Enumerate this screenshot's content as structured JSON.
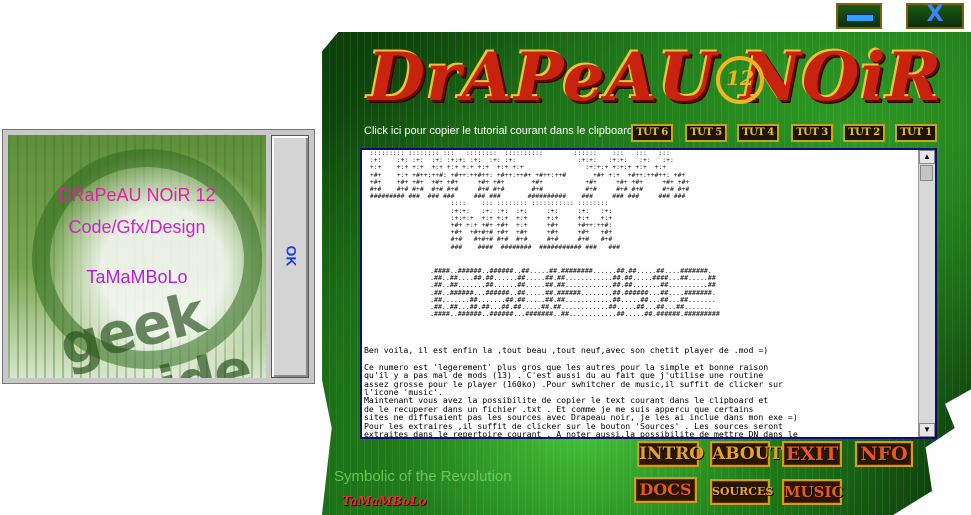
{
  "about": {
    "line1": "DRaPeAU NOiR 12",
    "line2": "Code/Gfx/Design",
    "line3": "TaMaMBoLo",
    "ok_label": "OK",
    "art_text": "geek inside"
  },
  "window": {
    "minimize_icon": "minimize-bar-icon",
    "close_glyph": "X"
  },
  "logo": {
    "title": "DrAPeAU NOiR",
    "number": "12"
  },
  "tutorials": {
    "copy_hint": "Click ici pour copier le tutorial courant dans le clipboard",
    "buttons": [
      "TUT 6",
      "TUT 5",
      "TUT 4",
      "TUT 3",
      "TUT 2",
      "TUT 1"
    ]
  },
  "editor": {
    "ascii_banner": " ::::::::: :::::::: :::   ::::::::  ::::::::::        ::::::    :::   :::   :::\n :+:    :+: :+:  :+: :+:+: :+:  :+: :+:                :+:+:   :+:+:   :+:   :+:\n +:+    +:+ +:+  +:+ +:+ +:+ +:+  +:+ +:+                :+:+:+ +:+:+ +:+  +:+\n +#+    +:+ +#++:++#: +#++:++#++: +#++:++#+ +#++:++#       +#+ +:+  +#++:++#++: +#+\n +#+    +#+ +#+  +#+ +#+     +#+ +#+       +#+           +#+     +#+ +#+     +#+ +#+\n #+#    #+# #+#  #+# #+#     #+# #+#       #+#           #+#     #+# #+#     #+# #+#\n ######### ###  ### ###     ### ###       ##########    ###     ### ###     ### ###\n                      ::::    ::: :::::::: ::::::::::: ::::::::\n                      :+:+:   :+: :+:  :+:     :+:     :+:   :+:\n                      :+:+:+  +:+ +:+  +:+     +:+     +:+   +:+\n                      +#+ +:+ +#+ +#+  +:+     +#+     +#++:++#:\n                      +#+  +#+#+# +#+  +#+     +#+     +#+   +#+\n                      #+#   #+#+# #+#  #+#     #+#     #+#   #+#\n                      ###    ####  ########  ########### ###   ###",
    "ascii_numbers": ".####..######..######..##.....##.########......##.##.....##....#######.\n.##..##....##.##......##.....##.##............##.##.....####...##.....##\n.##..##.......##......##.....##.##............##.##.......##..........##\n.##..######...######..##.....##.######........##.######...##....#######.\n.##.......##.......##.##.....##.##............##.....##...##...##.......\n.##..##...##.##...##.##.....##.##............##.....##...##...##.......\n.####..######..######...#######..##............##.....##.######.#########",
    "body": "Ben voila, il est enfin la ,tout beau ,tout neuf,avec son chetit player de .mod =)\n\nCe numero est 'legerement' plus gros que les autres pour la simple et bonne raison\nqu'il y a pas mal de mods (13) . C'est aussi du au fait que j'utilise une routine\nassez grosse pour le player (160ko) .Pour swhitcher de music,il suffit de clicker sur\nl'icone 'music'.\nMaintenant vous avez la possibilite de copier le text courant dans le clipboard et\nde le recuperer dans un fichier .txt . Et comme je me suis appercu que certains\nsites ne diffusaient pas les sources avec Drapeau noir, je les ai inclue dans mon exe =)\nPour les extraires ,il suffit de clicker sur le bouton 'Sources' . Les sources seront\nextraites dans le repertoire courant . A noter aussi,la possibilite de mettre DN dans le",
    "scroll_up": "▲",
    "scroll_down": "▼"
  },
  "menu": {
    "intro": "INTRO",
    "about": "ABOUT",
    "exit": "EXIT",
    "info": "NFO",
    "docs": "DOCS",
    "sources": "SOURCES",
    "music": "MUSIC"
  },
  "footer": {
    "slogan": "Symbolic of the Revolution",
    "credit": "TaMaMBoLo"
  },
  "colors": {
    "gold": "#e9a425",
    "logo_red": "#c8230e",
    "background_green": "#1c6716",
    "about_text_pink": "#e020a8",
    "ok_blue": "#1a3dd8"
  }
}
